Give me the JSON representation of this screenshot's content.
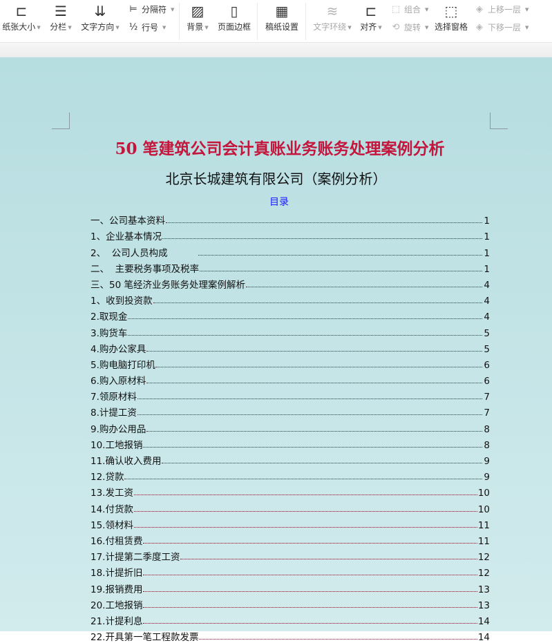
{
  "toolbar": {
    "paper_size": "纸张大小",
    "columns": "分栏",
    "text_direction": "文字方向",
    "separator": "分隔符",
    "line_number": "行号",
    "background": "背景",
    "page_border": "页面边框",
    "manuscript": "稿纸设置",
    "text_wrap": "文字环绕",
    "align": "对齐",
    "group": "组合",
    "rotate": "旋转",
    "selection_pane": "选择窗格",
    "bring_forward": "上移一层",
    "send_backward": "下移一层"
  },
  "document": {
    "title": "50 笔建筑公司会计真账业务账务处理案例分析",
    "subtitle": "北京长城建筑有限公司（案例分析）",
    "toc_heading": "目录",
    "toc": [
      {
        "label": "一、公司基本资料",
        "page": "1"
      },
      {
        "label": "1、企业基本情况",
        "page": "1"
      },
      {
        "label": "2、  公司人员构成          ",
        "page": "1"
      },
      {
        "label": "二、  主要税务事项及税率",
        "page": "1"
      },
      {
        "label": "三、50 笔经济业务账务处理案例解析",
        "page": "4"
      },
      {
        "label": "1、收到投资款",
        "page": "4"
      },
      {
        "label": "2.取现金",
        "page": "4"
      },
      {
        "label": "3.购货车",
        "page": "5"
      },
      {
        "label": "4.购办公家具",
        "page": "5"
      },
      {
        "label": "5.购电脑打印机",
        "page": "6"
      },
      {
        "label": "6.购入原材料",
        "page": "6"
      },
      {
        "label": "7.领原材料",
        "page": "7"
      },
      {
        "label": "8.计提工资",
        "page": "7"
      },
      {
        "label": "9.购办公用品",
        "page": "8"
      },
      {
        "label": "10.工地报销",
        "page": "8"
      },
      {
        "label": "11.确认收入费用",
        "page": "9"
      },
      {
        "label": "12.贷款",
        "page": "9"
      },
      {
        "label": "13.发工资",
        "page": "10"
      },
      {
        "label": "14.付货款",
        "page": "10"
      },
      {
        "label": "15.领材料",
        "page": "11"
      },
      {
        "label": "16.付租赁费",
        "page": "11"
      },
      {
        "label": "17.计提第二季度工资",
        "page": "12"
      },
      {
        "label": "18.计提折旧",
        "page": "12"
      },
      {
        "label": "19.报销费用",
        "page": "13"
      },
      {
        "label": "20.工地报销",
        "page": "13"
      },
      {
        "label": "21.计提利息",
        "page": "14"
      },
      {
        "label": "22.开具第一笔工程款发票",
        "page": "14"
      }
    ]
  }
}
